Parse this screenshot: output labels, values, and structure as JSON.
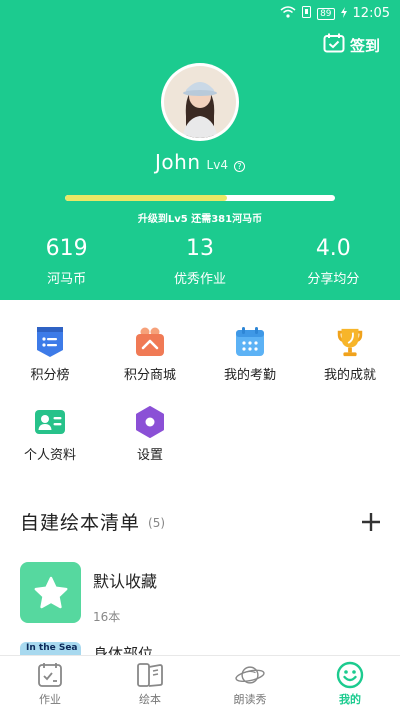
{
  "status_bar": {
    "time": "12:05",
    "battery": "89"
  },
  "header": {
    "checkin_label": "签到",
    "user_name": "John",
    "user_level": "Lv4",
    "help_glyph": "?",
    "progress_fraction": 0.6,
    "progress_text": "升级到Lv5  还需381河马币",
    "colors": {
      "background": "#1ccb8f",
      "progress_fill": "#e9e866"
    }
  },
  "stats": [
    {
      "value": "619",
      "label": "河马币"
    },
    {
      "value": "13",
      "label": "优秀作业"
    },
    {
      "value": "4.0",
      "label": "分享均分"
    }
  ],
  "features": [
    {
      "label": "积分榜",
      "icon": "leaderboard-icon"
    },
    {
      "label": "积分商城",
      "icon": "shop-icon"
    },
    {
      "label": "我的考勤",
      "icon": "calendar-icon"
    },
    {
      "label": "我的成就",
      "icon": "trophy-icon"
    },
    {
      "label": "个人资料",
      "icon": "profile-card-icon"
    },
    {
      "label": "设置",
      "icon": "settings-icon"
    }
  ],
  "booklist": {
    "title": "自建绘本清单",
    "count": "(5)",
    "items": [
      {
        "title": "默认收藏",
        "count": "16本"
      },
      {
        "cover_text": "In the Sea",
        "title": "身体部位"
      }
    ]
  },
  "tabs": [
    {
      "label": "作业",
      "icon": "homework-icon",
      "active": false
    },
    {
      "label": "绘本",
      "icon": "book-icon",
      "active": false
    },
    {
      "label": "朗读秀",
      "icon": "planet-icon",
      "active": false
    },
    {
      "label": "我的",
      "icon": "smile-icon",
      "active": true
    }
  ]
}
